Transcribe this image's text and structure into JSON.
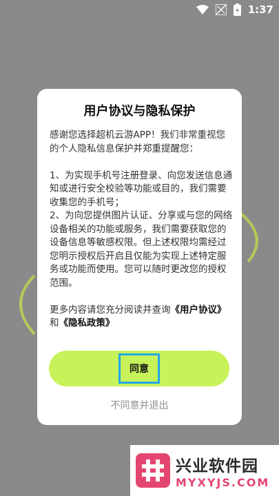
{
  "status_bar": {
    "time": "1:37",
    "icons": [
      "wifi-icon",
      "signal-icon",
      "battery-icon"
    ]
  },
  "dialog": {
    "title": "用户协议与隐私保护",
    "intro": "感谢您选择超机云游APP！我们非常重视您的个人隐私信息保护并郑重提醒您：",
    "item1": "1、为实现手机号注册登录、向您发送信息通知或进行安全校验等功能或目的，我们需要收集您的手机号；",
    "item2": "2、为向您提供图片认证、分享或与您的网络设备相关的功能或服务，我们需要获取您的设备信息等敏感权限。但上述权限均需经过您明示授权后开启且仅能为实现上述特定服务或功能而使用。您可以随时更改您的授权范围。",
    "more_prefix": "更多内容请您充分阅读并查询",
    "user_agreement": "《用户协议》",
    "and": "和",
    "privacy_policy": "《隐私政策》",
    "agree_label": "同意",
    "disagree_label": "不同意并退出"
  },
  "watermark": {
    "title": "兴业软件园",
    "url": "MYXYJS.COM"
  },
  "colors": {
    "overlay": "#8a8a8a",
    "agree_bg": "#c8f25a",
    "focus_border": "#22a8e6",
    "brand": "#e34671"
  }
}
